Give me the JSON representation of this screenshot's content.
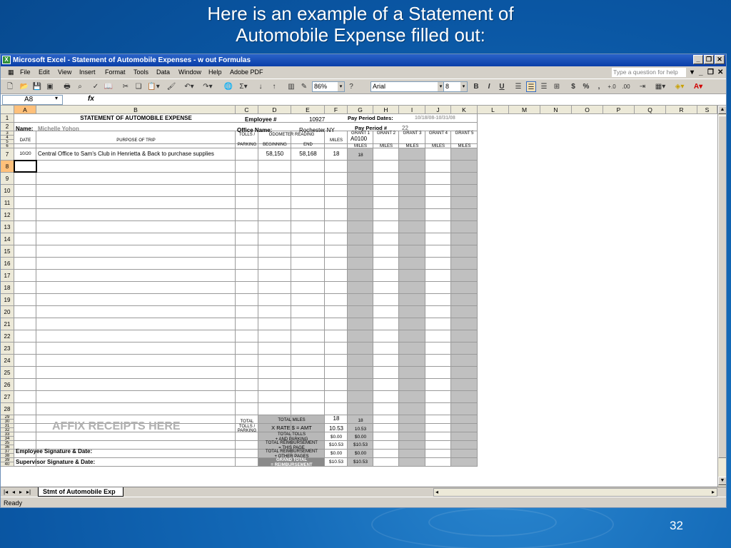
{
  "slide": {
    "title_line1": "Here is an example of a Statement of",
    "title_line2": "Automobile Expense filled out:",
    "page_number": "32"
  },
  "window": {
    "title": "Microsoft Excel - Statement of Automobile Expenses - w out Formulas",
    "app_icon": "excel-icon"
  },
  "menu": {
    "items": [
      "File",
      "Edit",
      "View",
      "Insert",
      "Format",
      "Tools",
      "Data",
      "Window",
      "Help",
      "Adobe PDF"
    ],
    "help_placeholder": "Type a question for help"
  },
  "toolbar": {
    "zoom": "86%",
    "font": "Arial",
    "font_size": "8",
    "bold": "B",
    "italic": "I",
    "underline": "U",
    "currency": "$",
    "percent": "%",
    "comma": ","
  },
  "formula_bar": {
    "name_box": "A8",
    "fx": "fx",
    "formula": ""
  },
  "columns": [
    "A",
    "B",
    "C",
    "D",
    "E",
    "F",
    "G",
    "H",
    "I",
    "J",
    "K",
    "L",
    "M",
    "N",
    "O",
    "P",
    "Q",
    "R",
    "S"
  ],
  "rows": [
    "1",
    "2",
    "3",
    "4",
    "5",
    "6",
    "7",
    "8",
    "9",
    "10",
    "11",
    "12",
    "13",
    "14",
    "15",
    "16",
    "17",
    "18",
    "19",
    "20",
    "21",
    "22",
    "23",
    "24",
    "25",
    "26",
    "27",
    "28",
    "29",
    "30",
    "31",
    "32",
    "33",
    "34",
    "35",
    "36",
    "37",
    "38",
    "39",
    "40"
  ],
  "sheet": {
    "header_title": "STATEMENT OF AUTOMOBILE EXPENSE",
    "employee_label": "Employee #",
    "employee_number": "10927",
    "pay_period_dates_label": "Pay Period Dates:",
    "pay_period_dates": "10/18/08-10/31/08",
    "name_label": "Name:",
    "name_value": "Michelle Yohon",
    "office_label": "Office Name:",
    "office_value": "Rochester NY",
    "pay_period_num_label": "Pay Period #",
    "pay_period_num": "22",
    "grants": [
      "GRANT 1",
      "GRANT 2",
      "GRANT 3",
      "GRANT 4",
      "GRANT 5"
    ],
    "grant_code": "A0100",
    "miles_labels": [
      "MILES",
      "MILES",
      "MILES",
      "MILES",
      "MILES"
    ],
    "date_label": "DATE",
    "purpose_label": "PURPOSE OF TRIP",
    "tolls_label_1": "TOLLS /",
    "tolls_label_2": "PARKING",
    "odometer_label": "ODOMETER READING",
    "beginning_label": "BEGINNING",
    "end_label": "END",
    "miles_label": "MILES",
    "entry": {
      "date": "10/20",
      "purpose": "Central Office to Sam's Club in Henrietta & Back to purchase supplies",
      "beginning": "58,150",
      "end": "58,168",
      "miles": "18",
      "grant1_miles": "18"
    },
    "affix_receipts": "AFFIX RECEIPTS HERE",
    "total_tolls_1": "TOTAL",
    "total_tolls_2": "TOLLS /",
    "total_tolls_3": "PARKING",
    "total_miles_label": "TOTAL MILES",
    "total_miles": "18",
    "total_miles_g": "18",
    "rate_label": "X RATE $ = AMT",
    "rate_value": "10.53",
    "rate_g": "10.53",
    "tt_label_1": "TOTAL TOLLS",
    "tt_label_2": "+ AND PARKING",
    "tt_value": "$0.00",
    "tt_g": "$0.00",
    "tr_page_1": "TOTAL REIMBURSEMENT",
    "tr_page_2": "= THIS PAGE",
    "tr_page_value": "$10.53",
    "tr_page_g": "$10.53",
    "tr_other_1": "TOTAL REIMBURSEMENT",
    "tr_other_2": "+ OTHER PAGES",
    "tr_other_value": "$0.00",
    "tr_other_g": "$0.00",
    "grand_1": "GRAND TOTAL",
    "grand_2": "= REIMBURSEMENT",
    "grand_value": "$10.53",
    "grand_g": "$10.53",
    "employee_sig": "Employee Signature & Date:",
    "supervisor_sig": "Supervisor Signature & Date:"
  },
  "sheet_tab": "Stmt of Automobile Exp",
  "status": "Ready"
}
